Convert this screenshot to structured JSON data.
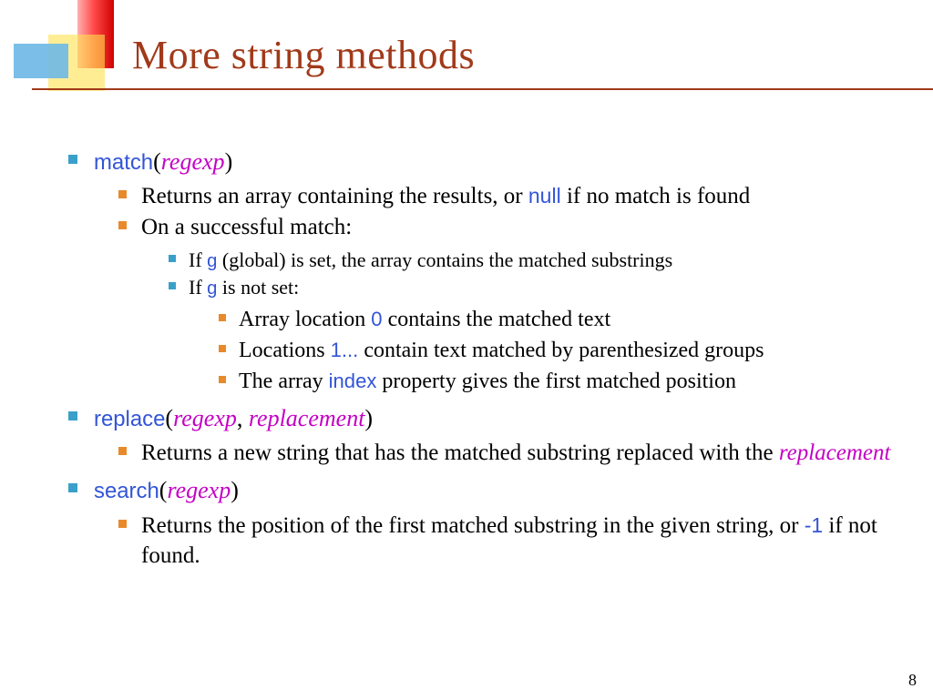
{
  "slide": {
    "title": "More string methods",
    "page_number": "8"
  },
  "b": {
    "match": {
      "name": "match",
      "open": "(",
      "arg": "regexp",
      "close": ")",
      "ret_a": "Returns an array containing the results, or ",
      "null": "null",
      "ret_b": " if no match is found",
      "succ": "On a successful match:",
      "g_set_a": "If ",
      "g": "g",
      "g_set_b": " (global) is set, the array contains the matched substrings",
      "g_not_a": "If ",
      "g_not_b": " is not set:",
      "loc0_a": "Array location ",
      "zero": "0",
      "loc0_b": " contains the matched text",
      "loc1_a": "Locations ",
      "onedots": "1...",
      "loc1_b": " contain text matched by parenthesized groups",
      "idx_a": "The array ",
      "index": "index",
      "idx_b": " property gives the first matched position"
    },
    "replace": {
      "name": "replace",
      "open": "(",
      "arg1": "regexp",
      "sep": ",  ",
      "arg2": "replacement",
      "close": ")",
      "ret_a": "Returns a new string that has the matched substring replaced with the ",
      "ret_b": "replacement"
    },
    "search": {
      "name": "search",
      "open": "(",
      "arg": "regexp",
      "close": ")",
      "ret_a": "Returns the position of the first matched substring in the given string, or ",
      "neg1": "-1",
      "ret_b": " if not found."
    }
  }
}
